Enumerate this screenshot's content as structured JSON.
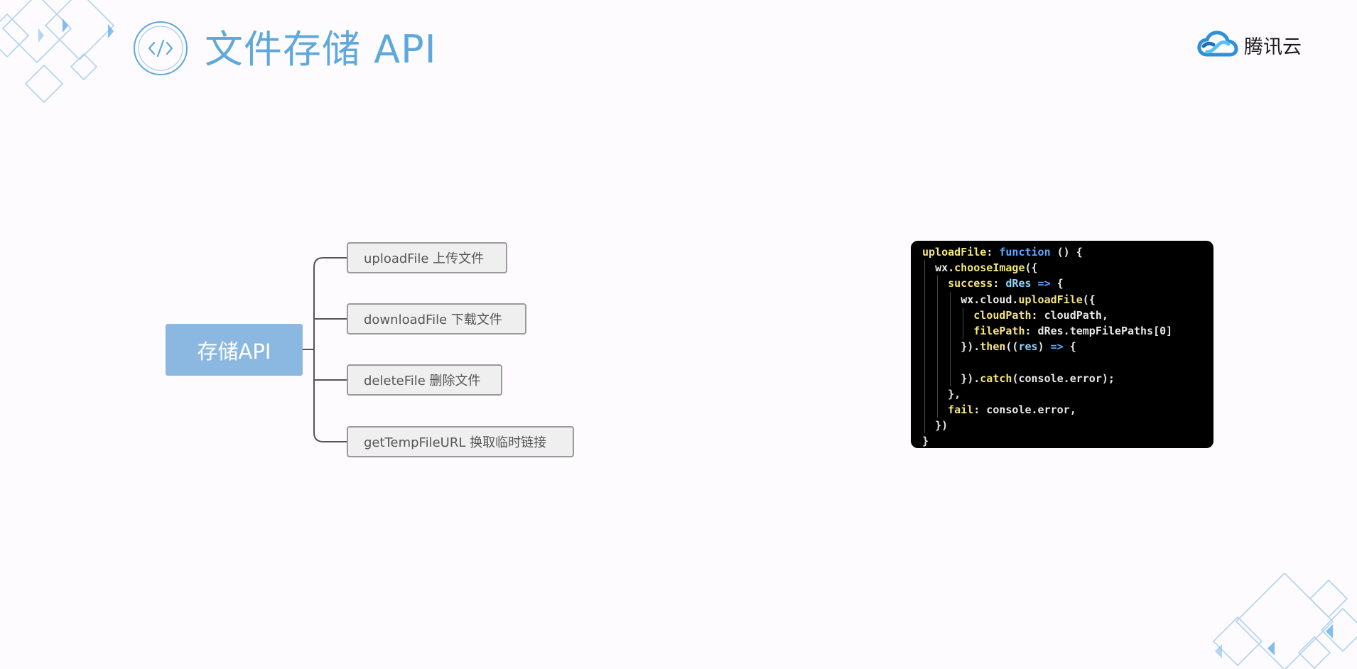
{
  "header": {
    "title": "文件存储 API",
    "brand_name": "腾讯云",
    "title_icon": "code-slash-icon",
    "brand_icon": "cloud-logo-icon"
  },
  "colors": {
    "title": "#5ea8dc",
    "root_node_bg": "#8bb8e0",
    "child_node_bg": "#efefef",
    "child_node_border": "#9a9a9a",
    "connector": "#555555",
    "code_bg": "#000000",
    "code_function_name": "#f5e67a",
    "code_keyword": "#5aa8ff",
    "code_identifier": "#e8e8e8",
    "decoration": "#6fb3e6"
  },
  "mindmap": {
    "root": "存储API",
    "children": [
      {
        "label": "uploadFile 上传文件"
      },
      {
        "label": "downloadFile 下载文件"
      },
      {
        "label": "deleteFile 删除文件"
      },
      {
        "label": "getTempFileURL 换取临时链接"
      }
    ]
  },
  "code": {
    "lines": [
      {
        "indent": 0,
        "tokens": [
          {
            "t": "uploadFile",
            "c": "fn"
          },
          {
            "t": ": ",
            "c": "pu"
          },
          {
            "t": "function",
            "c": "kw"
          },
          {
            "t": " () {",
            "c": "pu"
          }
        ]
      },
      {
        "indent": 1,
        "tokens": [
          {
            "t": "wx.",
            "c": "id"
          },
          {
            "t": "chooseImage",
            "c": "fn"
          },
          {
            "t": "({",
            "c": "pu"
          }
        ]
      },
      {
        "indent": 2,
        "tokens": [
          {
            "t": "success",
            "c": "fn"
          },
          {
            "t": ": ",
            "c": "pu"
          },
          {
            "t": "dRes",
            "c": "pr"
          },
          {
            "t": " => ",
            "c": "kw"
          },
          {
            "t": "{",
            "c": "pu"
          }
        ]
      },
      {
        "indent": 3,
        "tokens": [
          {
            "t": "wx.cloud.",
            "c": "id"
          },
          {
            "t": "uploadFile",
            "c": "fn"
          },
          {
            "t": "({",
            "c": "pu"
          }
        ]
      },
      {
        "indent": 4,
        "tokens": [
          {
            "t": "cloudPath",
            "c": "fn"
          },
          {
            "t": ": cloudPath,",
            "c": "id"
          }
        ]
      },
      {
        "indent": 4,
        "tokens": [
          {
            "t": "filePath",
            "c": "fn"
          },
          {
            "t": ": dRes.tempFilePaths[0]",
            "c": "id"
          }
        ]
      },
      {
        "indent": 3,
        "tokens": [
          {
            "t": "}).",
            "c": "pu"
          },
          {
            "t": "then",
            "c": "fn"
          },
          {
            "t": "((",
            "c": "pu"
          },
          {
            "t": "res",
            "c": "pr"
          },
          {
            "t": ") ",
            "c": "pu"
          },
          {
            "t": "=>",
            "c": "kw"
          },
          {
            "t": " {",
            "c": "pu"
          }
        ]
      },
      {
        "indent": 3,
        "tokens": []
      },
      {
        "indent": 3,
        "tokens": [
          {
            "t": "}).",
            "c": "pu"
          },
          {
            "t": "catch",
            "c": "fn"
          },
          {
            "t": "(console.error);",
            "c": "id"
          }
        ]
      },
      {
        "indent": 2,
        "tokens": [
          {
            "t": "},",
            "c": "pu"
          }
        ]
      },
      {
        "indent": 2,
        "tokens": [
          {
            "t": "fail",
            "c": "fn"
          },
          {
            "t": ": console.error,",
            "c": "id"
          }
        ]
      },
      {
        "indent": 1,
        "tokens": [
          {
            "t": "})",
            "c": "pu"
          }
        ]
      },
      {
        "indent": 0,
        "tokens": [
          {
            "t": "}",
            "c": "pu"
          }
        ]
      }
    ]
  }
}
